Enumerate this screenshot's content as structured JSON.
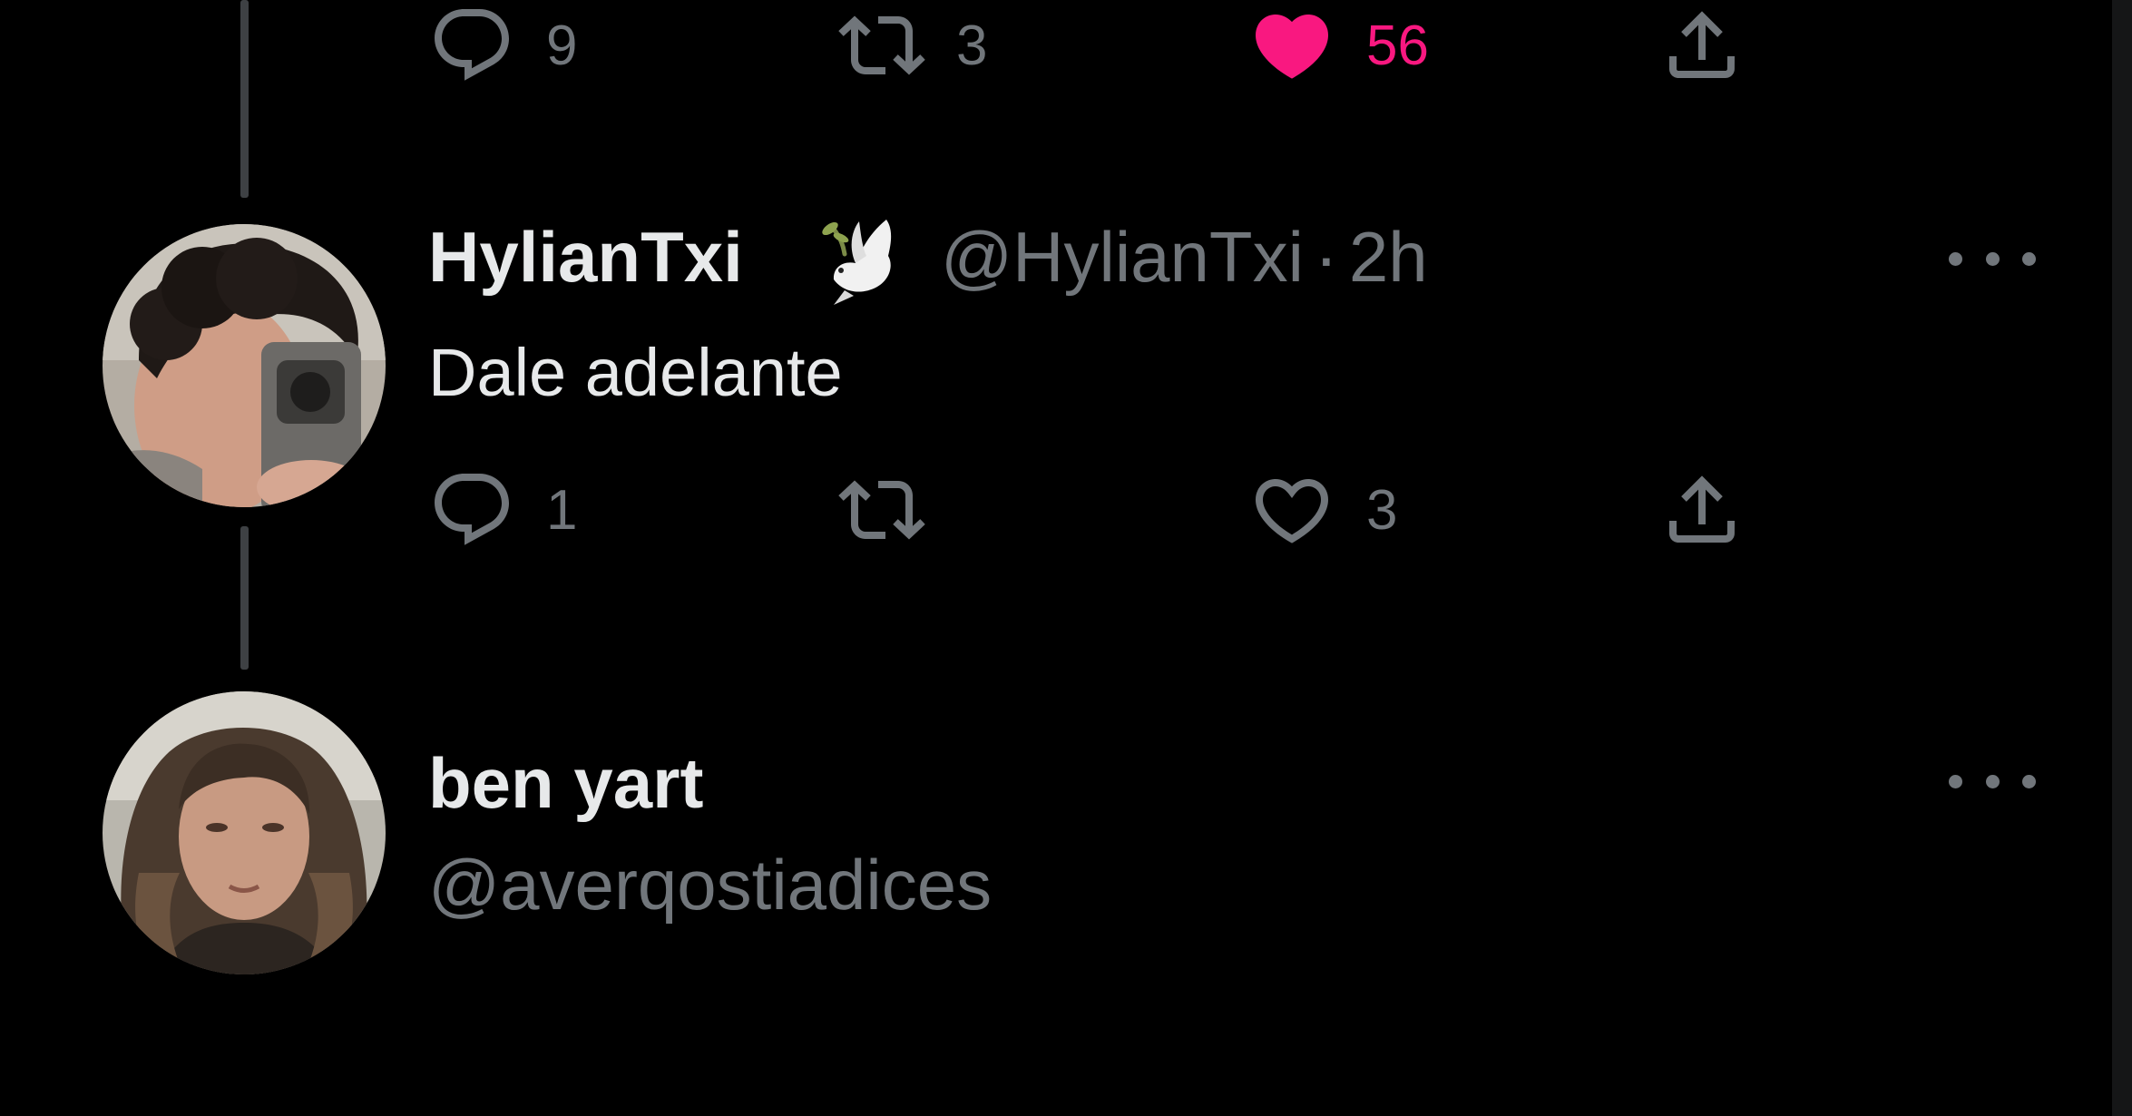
{
  "colors": {
    "background": "#000000",
    "primary_text": "#e7e9ea",
    "secondary_text": "#71767b",
    "like_pink": "#f91880",
    "thread_line": "#3e4144"
  },
  "previous_tweet": {
    "actions": {
      "replies": "9",
      "retweets": "3",
      "likes": "56",
      "liked": true
    }
  },
  "tweets": [
    {
      "author": {
        "name": "HylianTxi",
        "badge_icon": "dove-with-olive-branch-icon",
        "handle": "@HylianTxi",
        "separator": "·",
        "time": "2h"
      },
      "text": "Dale adelante",
      "actions": {
        "replies": "1",
        "retweets": "",
        "likes": "3",
        "liked": false
      }
    },
    {
      "author": {
        "name": "ben yart",
        "handle": "@averqostiadices"
      }
    }
  ]
}
